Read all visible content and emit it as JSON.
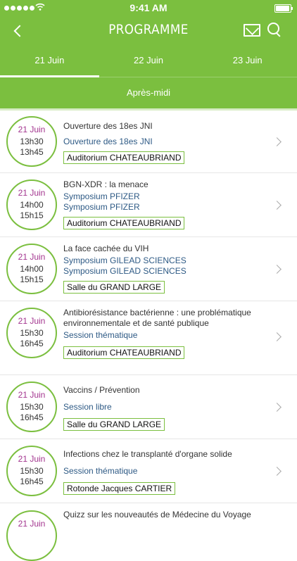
{
  "status_bar": {
    "time": "9:41 AM"
  },
  "header": {
    "title": "PROGRAMME"
  },
  "tabs": [
    {
      "label": "21 Juin"
    },
    {
      "label": "22 Juin"
    },
    {
      "label": "23 Juin"
    }
  ],
  "period": "Après-midi",
  "colors": {
    "accent": "#7bbf3f",
    "date": "#a3358f",
    "session": "#2e5a85"
  },
  "sessions": [
    {
      "date": "21 Juin",
      "start": "13h30",
      "end": "13h45",
      "title": "Ouverture des 18es JNI",
      "subtitle": "Ouverture des 18es JNI",
      "room": "Auditorium CHATEAUBRIAND"
    },
    {
      "date": "21 Juin",
      "start": "14h00",
      "end": "15h15",
      "title": "BGN-XDR : la menace",
      "subtitle": "Symposium PFIZER",
      "subtitle2": "Symposium PFIZER",
      "room": "Auditorium CHATEAUBRIAND"
    },
    {
      "date": "21 Juin",
      "start": "14h00",
      "end": "15h15",
      "title": "La face cachée du VIH",
      "subtitle": "Symposium GILEAD SCIENCES",
      "subtitle2": "Symposium GILEAD SCIENCES",
      "room": "Salle du GRAND LARGE"
    },
    {
      "date": "21 Juin",
      "start": "15h30",
      "end": "16h45",
      "title": "Antibiorésistance bactérienne : une problématique environnementale et de santé publique",
      "subtitle": "Session thématique",
      "room": "Auditorium CHATEAUBRIAND"
    },
    {
      "date": "21 Juin",
      "start": "15h30",
      "end": "16h45",
      "title": "Vaccins / Prévention",
      "subtitle": "Session libre",
      "room": "Salle du GRAND LARGE"
    },
    {
      "date": "21 Juin",
      "start": "15h30",
      "end": "16h45",
      "title": "Infections chez le transplanté d'organe solide",
      "subtitle": "Session thématique",
      "room": "Rotonde Jacques CARTIER"
    },
    {
      "date": "21 Juin",
      "start": "",
      "end": "",
      "title": "Quizz sur les nouveautés de Médecine du Voyage",
      "subtitle": "",
      "room": ""
    }
  ]
}
